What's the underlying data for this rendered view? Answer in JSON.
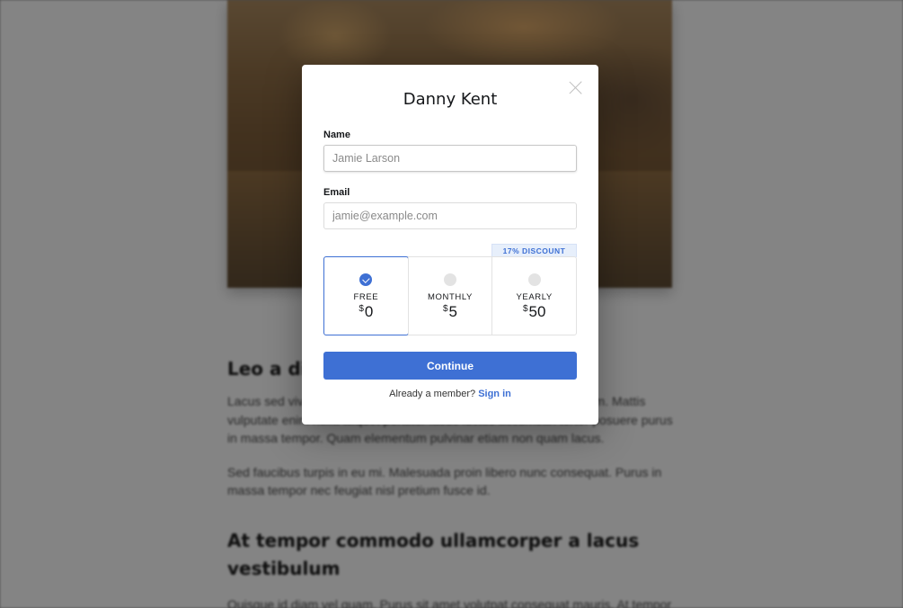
{
  "background": {
    "article": {
      "heading_1": "Leo a diam sollicitudin tempor id eu",
      "paragraph_1": "Lacus sed viverra tellus in hac habitasse platea dictumst vestibulum. Mattis vulputate enim nulla aliquet porttitor lacus luctus accumsan tortor posuere purus in massa tempor. Quam elementum pulvinar etiam non quam lacus.",
      "paragraph_2": "Sed faucibus turpis in eu mi. Malesuada proin libero nunc consequat. Purus in massa tempor nec feugiat nisl pretium fusce id.",
      "heading_2": "At tempor commodo ullamcorper a lacus vestibulum",
      "paragraph_3": "Quisque id diam vel quam. Purus sit amet volutpat consequat mauris. At tempor"
    }
  },
  "modal": {
    "title": "Danny Kent",
    "name_label": "Name",
    "name_placeholder": "Jamie Larson",
    "email_label": "Email",
    "email_placeholder": "jamie@example.com",
    "discount_badge": "17% DISCOUNT",
    "plans": [
      {
        "name": "FREE",
        "currency": "$",
        "price": "0",
        "selected": true
      },
      {
        "name": "MONTHLY",
        "currency": "$",
        "price": "5",
        "selected": false
      },
      {
        "name": "YEARLY",
        "currency": "$",
        "price": "50",
        "selected": false
      }
    ],
    "continue_label": "Continue",
    "member_text": "Already a member?",
    "signin_label": "Sign in"
  },
  "colors": {
    "accent": "#3e70d4",
    "overlay": "rgba(10,10,10,.5)"
  }
}
